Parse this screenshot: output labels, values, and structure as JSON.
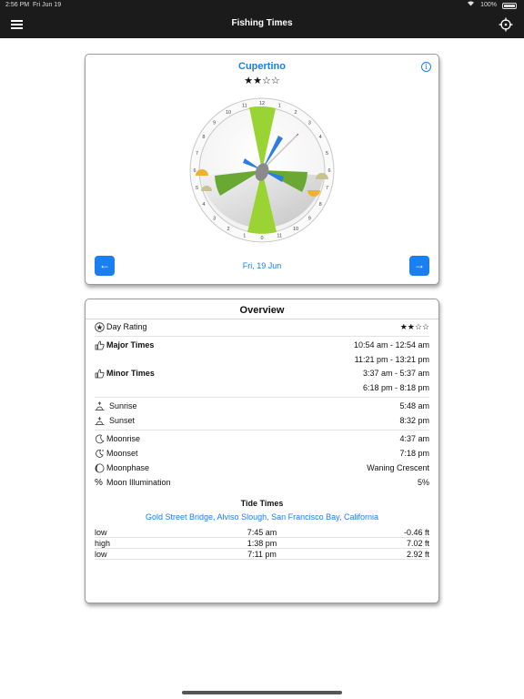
{
  "statusbar": {
    "time": "2:56 PM",
    "date": "Fri Jun 19",
    "battery": "100%"
  },
  "navbar": {
    "title": "Fishing Times",
    "menu_icon": "hamburger-icon",
    "locate_icon": "crosshair-icon"
  },
  "forecast": {
    "city": "Cupertino",
    "stars": "★★☆☆",
    "info_icon": "i",
    "date": "Fri, 19 Jun",
    "prev_label": "←",
    "next_label": "→",
    "dial_hours": [
      "12",
      "1",
      "2",
      "3",
      "4",
      "5",
      "6",
      "7",
      "8",
      "9",
      "10",
      "11",
      "0",
      "1",
      "2",
      "3",
      "4",
      "5",
      "6",
      "7",
      "8",
      "9",
      "10",
      "11"
    ]
  },
  "overview": {
    "title": "Overview",
    "day_rating": {
      "label": "Day Rating",
      "value": "★★☆☆"
    },
    "major": {
      "label": "Major Times",
      "values": [
        "10:54 am - 12:54 am",
        "11:21 pm - 13:21 pm"
      ]
    },
    "minor": {
      "label": "Minor Times",
      "values": [
        "3:37 am - 5:37 am",
        "6:18 pm - 8:18 pm"
      ]
    },
    "sunrise": {
      "label": "Sunrise",
      "value": "5:48 am"
    },
    "sunset": {
      "label": "Sunset",
      "value": "8:32 pm"
    },
    "moonrise": {
      "label": "Moonrise",
      "value": "4:37 am"
    },
    "moonset": {
      "label": "Moonset",
      "value": "7:18 pm"
    },
    "moonphase": {
      "label": "Moonphase",
      "value": "Waning Crescent"
    },
    "illumination": {
      "label": "Moon Illumination",
      "value": "5%",
      "icon_glyph": "%"
    }
  },
  "tides": {
    "title": "Tide Times",
    "location": "Gold Street Bridge, Alviso Slough, San Francisco Bay, California",
    "rows": [
      {
        "type": "low",
        "time": "7:45 am",
        "height": "-0.46 ft"
      },
      {
        "type": "high",
        "time": "1:38 pm",
        "height": "7.02 ft"
      },
      {
        "type": "low",
        "time": "7:11 pm",
        "height": "2.92 ft"
      }
    ]
  },
  "colors": {
    "accent": "#1a7ff0",
    "bar": "#1b1b1b",
    "major_green": "#9ad434",
    "minor_green": "#6aa834",
    "blue_mark": "#2a7fe0",
    "sun": "#f0b030"
  }
}
